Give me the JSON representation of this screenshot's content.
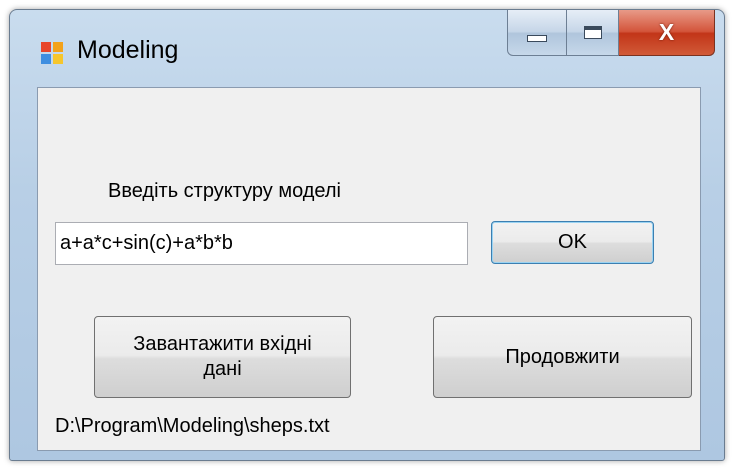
{
  "window": {
    "title": "Modeling",
    "icon": "app-window-icon",
    "caption_buttons": {
      "minimize": "minimize-icon",
      "maximize": "maximize-icon",
      "close": "close-icon",
      "close_glyph": "X"
    }
  },
  "form": {
    "structure_label": "Введіть структуру моделі",
    "structure_value": "a+a*c+sin(c)+a*b*b",
    "ok_label": "OK",
    "load_label_line1": "Завантажити вхідні",
    "load_label_line2": "дані",
    "continue_label": "Продовжити",
    "file_path": "D:\\Program\\Modeling\\sheps.txt"
  },
  "colors": {
    "close_button": "#c23518",
    "frame": "#b8cfe6",
    "client_background": "#f0f0f0",
    "default_button_border": "#3c7fb1"
  }
}
